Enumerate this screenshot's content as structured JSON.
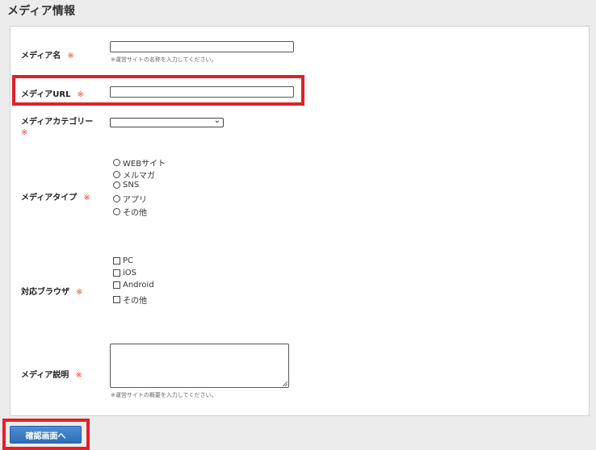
{
  "page": {
    "title": "メディア情報"
  },
  "form": {
    "required_mark": "※",
    "media_name": {
      "label": "メディア名",
      "value": "",
      "hint": "※運営サイトの名称を入力してください。"
    },
    "media_url": {
      "label": "メディアURL",
      "value": ""
    },
    "media_category": {
      "label": "メディアカテゴリー",
      "selected": ""
    },
    "media_type": {
      "label": "メディアタイプ",
      "options": [
        "WEBサイト",
        "メルマガ",
        "SNS",
        "アプリ",
        "その他"
      ]
    },
    "browser": {
      "label": "対応ブラウザ",
      "options": [
        "PC",
        "iOS",
        "Android",
        "その他"
      ]
    },
    "media_description": {
      "label": "メディア説明",
      "value": "",
      "hint": "※運営サイトの概要を入力してください。"
    }
  },
  "submit_label": "確認画面へ",
  "highlight_color": "#e0202a",
  "accent_color": "#2c6db8"
}
